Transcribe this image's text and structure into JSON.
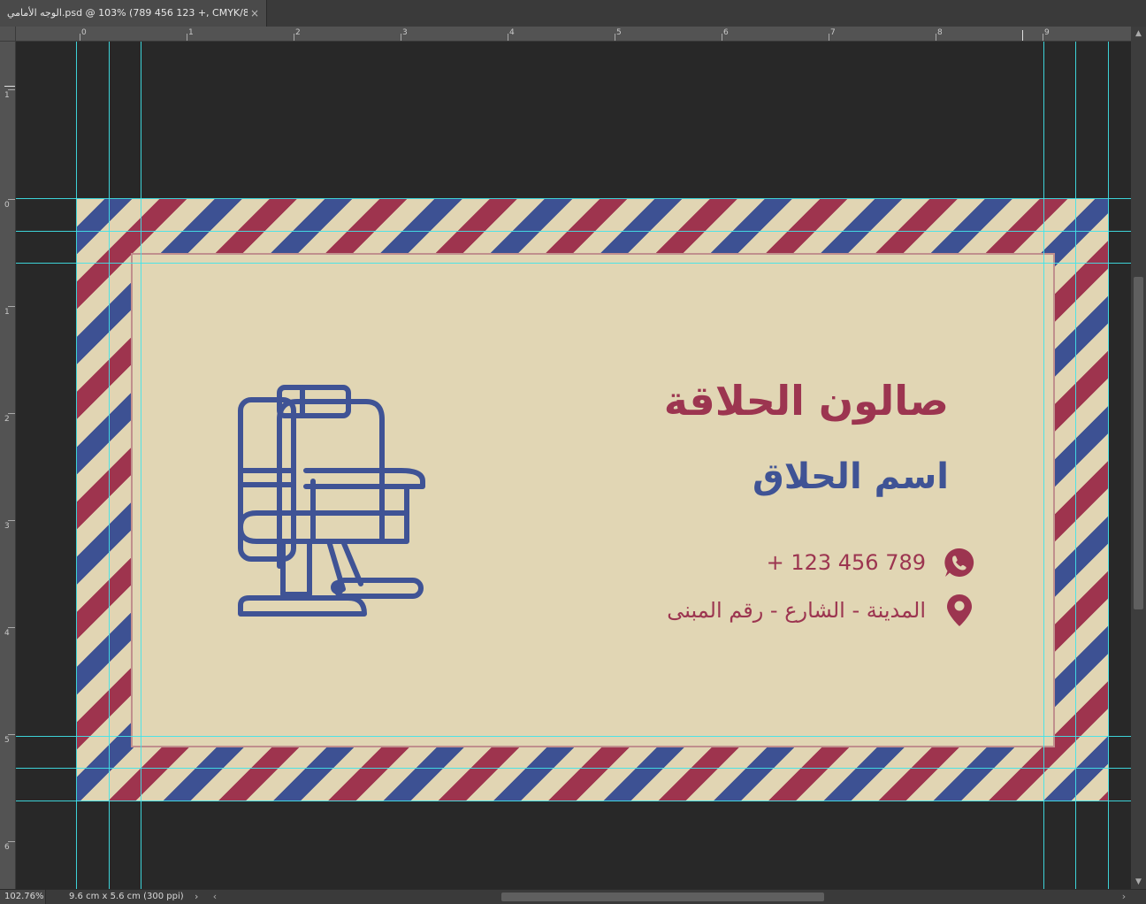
{
  "tab": {
    "title": "الوجه الأمامي.psd @ 103% (789 456 123 +, CMYK/8#)",
    "close_glyph": "×"
  },
  "ruler": {
    "horizontal_labels": [
      "0",
      "1",
      "2",
      "3",
      "4",
      "5",
      "6",
      "7",
      "8",
      "9"
    ],
    "vertical_labels": [
      "1",
      "0",
      "1",
      "2",
      "3",
      "4",
      "5",
      "6"
    ]
  },
  "card": {
    "shop_name": "صالون الحلاقة",
    "barber_name": "اسم الحلاق",
    "phone": "+ 123 456 789",
    "address": "المدينة - الشارع - رقم المبنى",
    "colors": {
      "background": "#e1d6b4",
      "red": "#9c3550",
      "blue": "#3f5395",
      "frame_line": "#c08f8d"
    },
    "icons": {
      "chair": "barber-chair-icon",
      "phone": "whatsapp-icon",
      "address": "map-pin-icon"
    }
  },
  "status": {
    "zoom": "102.76%",
    "doc_info": "9.6 cm x 5.6 cm (300 ppi)"
  }
}
